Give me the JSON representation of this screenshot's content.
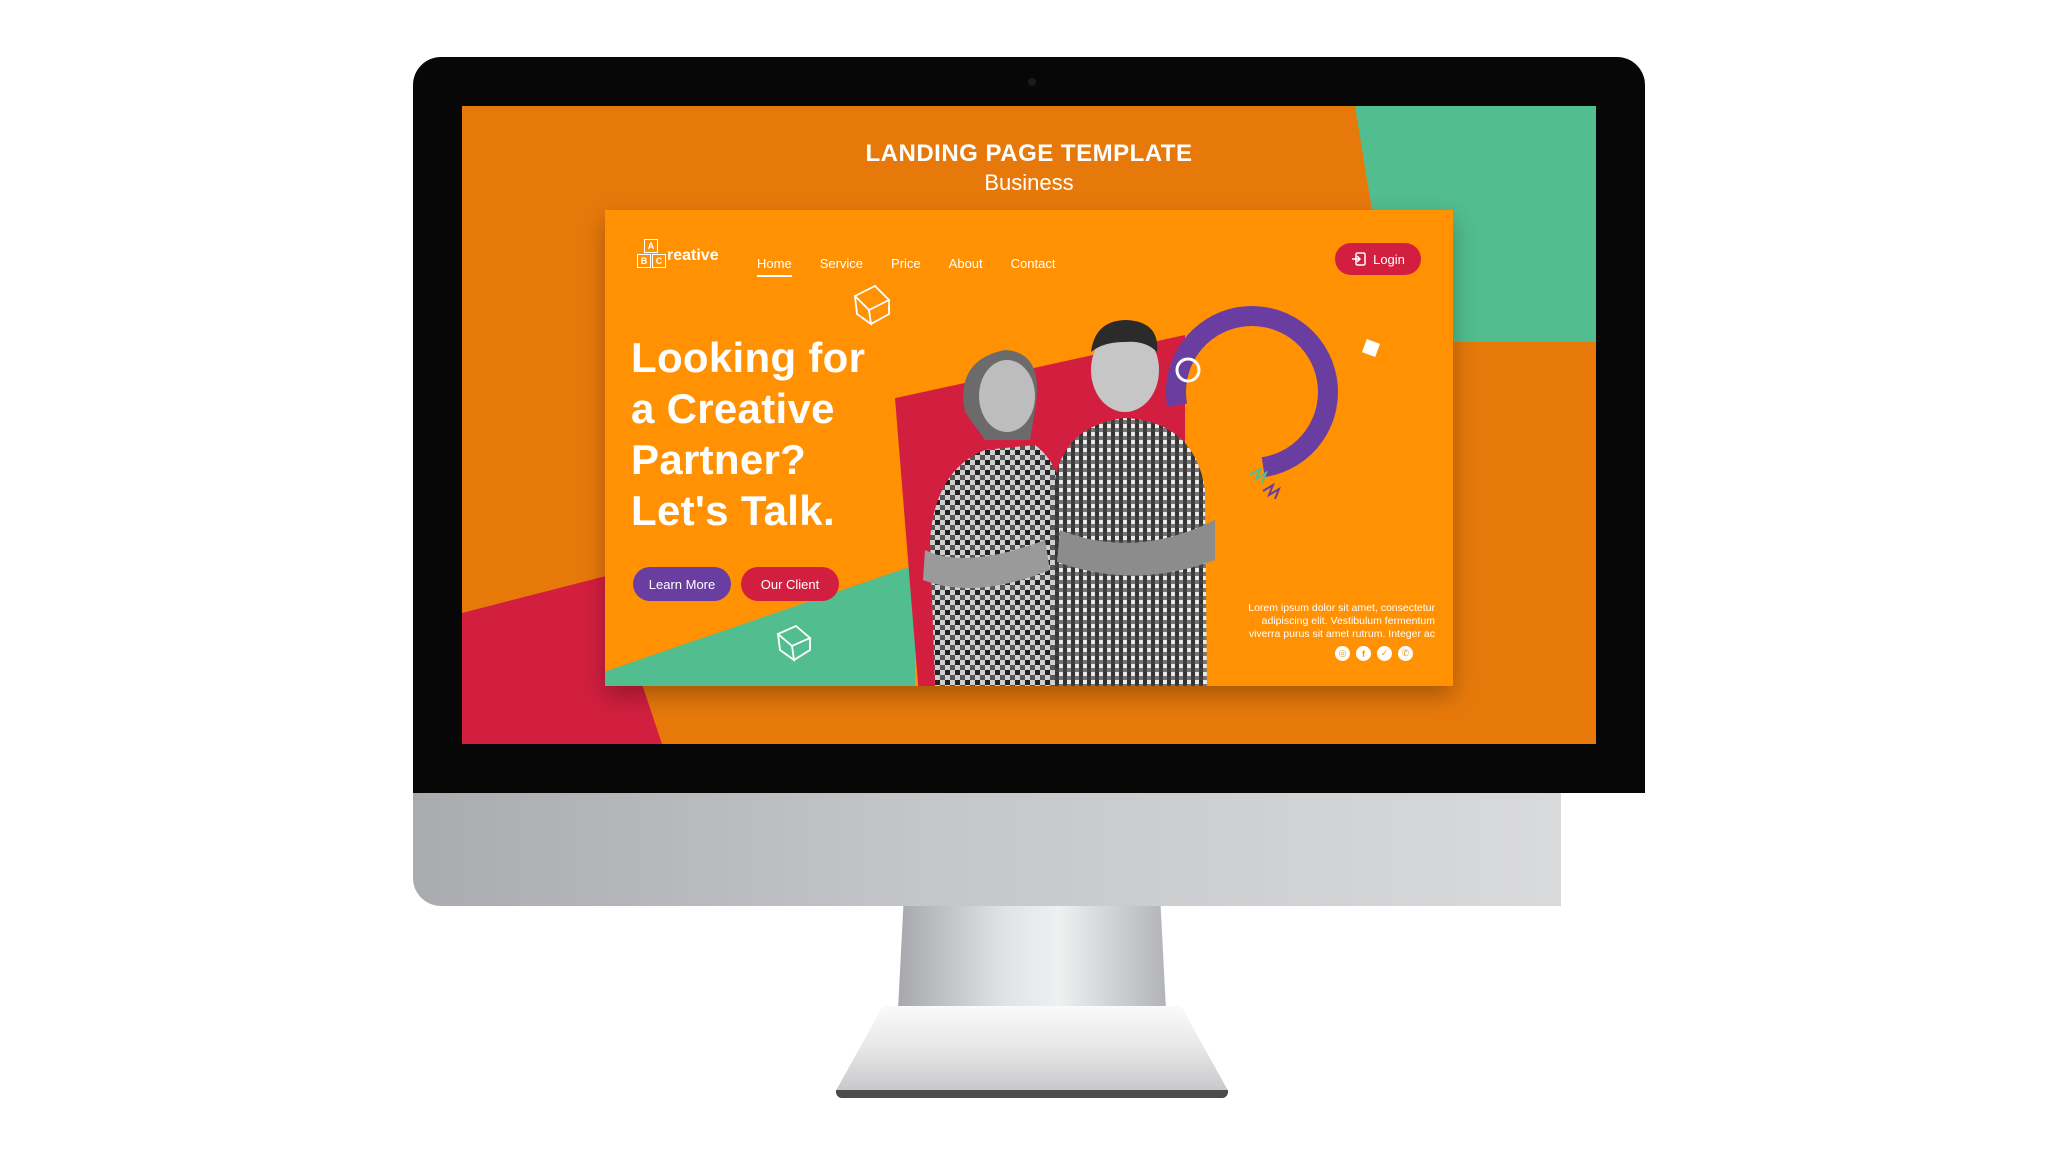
{
  "template_header": {
    "title": "LANDING PAGE TEMPLATE",
    "subtitle": "Business"
  },
  "brand": {
    "logo_letters": [
      "A",
      "B",
      "C"
    ],
    "logo_text": "reative"
  },
  "nav": {
    "items": [
      {
        "label": "Home",
        "active": true
      },
      {
        "label": "Service",
        "active": false
      },
      {
        "label": "Price",
        "active": false
      },
      {
        "label": "About",
        "active": false
      },
      {
        "label": "Contact",
        "active": false
      }
    ]
  },
  "login_label": "Login",
  "hero": {
    "lines": [
      "Looking for",
      "a Creative",
      "Partner?",
      "Let's Talk."
    ],
    "primary_button": "Learn More",
    "secondary_button": "Our Client",
    "body_lines": [
      "Lorem ipsum dolor sit amet, consectetur",
      "adipiscing elit. Vestibulum fermentum",
      "viverra purus sit amet rutrum. Integer ac"
    ]
  },
  "social_icons": [
    "instagram-icon",
    "facebook-icon",
    "twitter-icon",
    "whatsapp-icon"
  ],
  "colors": {
    "screen_orange": "#e7790b",
    "card_orange": "#ff9102",
    "green": "#52bd8e",
    "red": "#d21f3f",
    "purple": "#6a3ea1"
  }
}
